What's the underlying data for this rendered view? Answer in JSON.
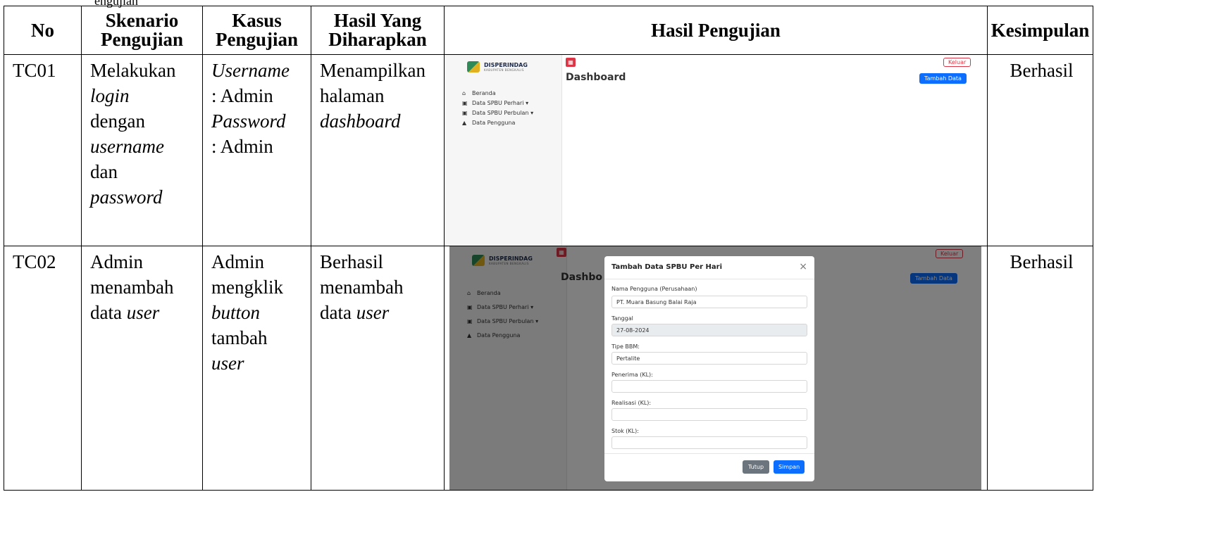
{
  "caption": "engujian",
  "headers": {
    "no": "No",
    "skenario": [
      "Skenario",
      "Pengujian"
    ],
    "kasus": [
      "Kasus",
      "Pengujian"
    ],
    "hasil_harap": [
      "Hasil Yang",
      "Diharapkan"
    ],
    "hasil": "Hasil Pengujian",
    "kesimpulan": "Kesimpulan"
  },
  "rows": [
    {
      "no": "TC01",
      "skenario": [
        "Melakukan",
        "login",
        "dengan",
        "username",
        "dan",
        "password"
      ],
      "kasus": [
        "Username",
        ": Admin",
        "Password",
        ": Admin"
      ],
      "harap": [
        "Menampilkan",
        "halaman",
        "dashboard"
      ],
      "kesimpulan": "Berhasil"
    },
    {
      "no": "TC02",
      "skenario": [
        "Admin",
        "menambah",
        "data",
        "user"
      ],
      "kasus": [
        "Admin",
        "mengklik",
        "button",
        "tambah",
        "user"
      ],
      "harap": [
        "Berhasil",
        "menambah",
        "data",
        "user"
      ],
      "kesimpulan": "Berhasil"
    }
  ],
  "app": {
    "logo_title": "DISPERINDAG",
    "logo_sub": "KABUPATEN BENGKALIS",
    "nav": [
      "Beranda",
      "Data SPBU Perhari",
      "Data SPBU Perbulan",
      "Data Pengguna"
    ],
    "logout": "Keluar",
    "page_title": "Dashboard",
    "page_title_cut": "Dashbo",
    "add_button": "Tambah Data"
  },
  "modal": {
    "title": "Tambah Data SPBU Per Hari",
    "fields": [
      {
        "label": "Nama Pengguna (Perusahaan)",
        "value": "PT. Muara Basung Balai Raja"
      },
      {
        "label": "Tanggal",
        "value": "27-08-2024"
      },
      {
        "label": "Tipe BBM:",
        "value": "Pertalite"
      },
      {
        "label": "Penerima (KL):",
        "value": ""
      },
      {
        "label": "Realisasi (KL):",
        "value": ""
      },
      {
        "label": "Stok (KL):",
        "value": ""
      }
    ],
    "close_label": "Tutup",
    "save_label": "Simpan"
  }
}
